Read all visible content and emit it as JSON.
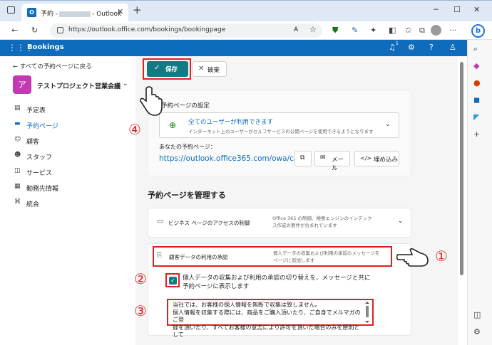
{
  "browser": {
    "tab_title_prefix": "予約 -",
    "tab_title_suffix": "- Outlook",
    "tab_icon": "O",
    "url": "https://outlook.office.com/bookings/bookingpage"
  },
  "app": {
    "name": "Bookings",
    "notification_count": "5"
  },
  "leftnav": {
    "back": "すべての予約ページに戻る",
    "avatar": "ア",
    "business_name": "テストプロジェクト営業会議",
    "items": [
      {
        "icon": "calendar-icon",
        "glyph": "▤",
        "label": "予定表"
      },
      {
        "icon": "booking-page-icon",
        "glyph": "▬",
        "label": "予約ページ"
      },
      {
        "icon": "customers-icon",
        "glyph": "☺",
        "label": "顧客"
      },
      {
        "icon": "staff-icon",
        "glyph": "☻",
        "label": "スタッフ"
      },
      {
        "icon": "services-icon",
        "glyph": "◫",
        "label": "サービス"
      },
      {
        "icon": "business-hours-icon",
        "glyph": "▦",
        "label": "勤務先情報"
      },
      {
        "icon": "integrations-icon",
        "glyph": "⌘",
        "label": "統合"
      }
    ]
  },
  "toolbar": {
    "save_label": "保存",
    "discard_label": "破棄"
  },
  "booking_settings": {
    "title": "予約ページの設定",
    "dropdown_title": "全てのユーザーが利用できます",
    "dropdown_desc": "インターネット上のユーザーがセルフサービスの公開ページを使用できるようになります",
    "page_label": "あなたの予約ページ：",
    "page_url": "https://outlook.office365.com/owa/ca...",
    "mail_label": "メール",
    "embed_label": "埋め込み"
  },
  "manage": {
    "title": "予約ページを管理する",
    "access_title": "ビジネス ページのアクセスの制御",
    "access_desc": "Office 365 の制御、検索エンジンのインデックス作成の要件が含まれています",
    "consent_title": "顧客データの利用の承認",
    "consent_desc": "個人データの収集および利用の承認のメッセージをページに追加します",
    "checkbox_label": "個人データの収集および利用の承認の切り替えを、メッセージと共に予約ページに表示します",
    "message": "当社では、お客様の個人情報を無断で収集は致しません。\n個人情報を収集する際には、商品をご購入頂いたり、ご自身でメルマガのご登\n録を頂いたり、すべてお客様の意志により許可を頂いた場合のみを原則として"
  },
  "annotations": {
    "n1": "①",
    "n2": "②",
    "n3": "③",
    "n4": "④"
  },
  "colors": {
    "accent": "#0f6cbd",
    "save": "#117a82",
    "annotation": "#e02020"
  }
}
